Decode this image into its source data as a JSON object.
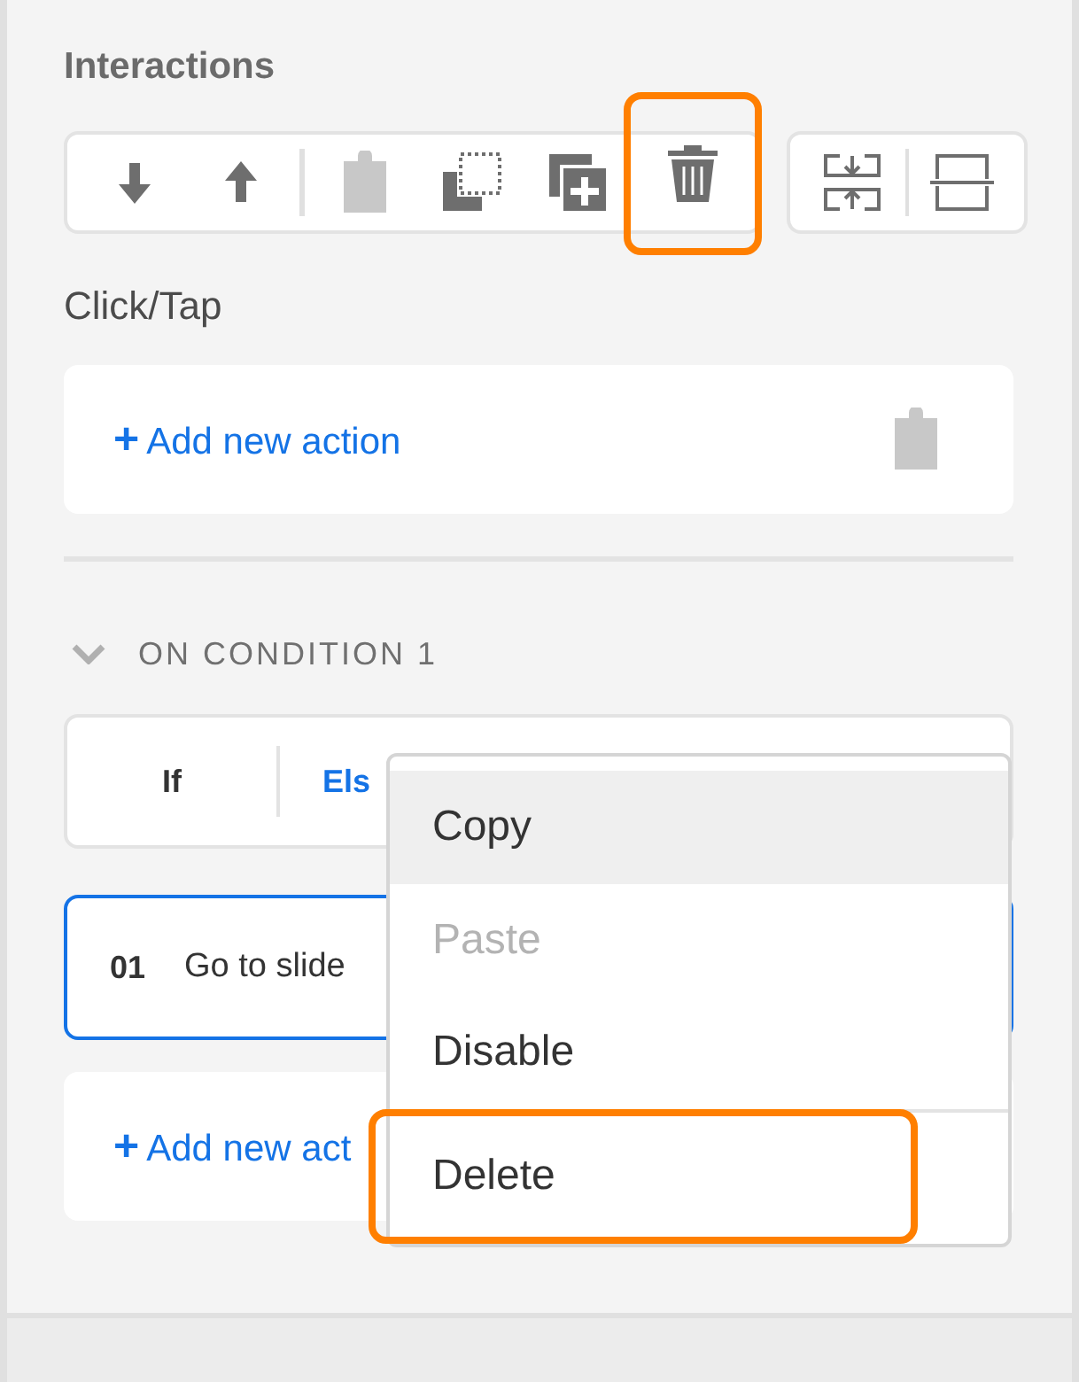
{
  "panel": {
    "title": "Interactions"
  },
  "toolbar": {
    "groups": [
      {
        "tools": [
          {
            "disabled": false,
            "highlighted": false
          },
          {
            "disabled": false,
            "highlighted": false
          },
          {
            "disabled": true,
            "highlighted": false
          },
          {
            "disabled": false,
            "highlighted": false
          },
          {
            "disabled": false,
            "highlighted": false
          },
          {
            "disabled": false,
            "highlighted": true
          }
        ]
      },
      {
        "tools": [
          {
            "disabled": false,
            "highlighted": false
          },
          {
            "disabled": false,
            "highlighted": false
          }
        ]
      }
    ]
  },
  "trigger": {
    "label": "Click/Tap",
    "add_action": {
      "plus": "+",
      "label": "Add new action"
    }
  },
  "condition": {
    "title": "ON CONDITION 1",
    "expanded": true,
    "tabs": [
      {
        "label": "If",
        "selected": false
      },
      {
        "label": "Els",
        "selected": true
      }
    ],
    "actions": [
      {
        "number": "01",
        "label": "Go to slide",
        "selected": true
      }
    ],
    "add_action": {
      "plus": "+",
      "label": "Add new act"
    }
  },
  "context_menu": {
    "items": [
      {
        "label": "Copy",
        "hovered": true,
        "disabled": false,
        "highlighted": false
      },
      {
        "label": "Paste",
        "hovered": false,
        "disabled": true,
        "highlighted": false
      },
      {
        "label": "Disable",
        "hovered": false,
        "disabled": false,
        "highlighted": false
      },
      {
        "label": "Delete",
        "hovered": false,
        "disabled": false,
        "highlighted": true
      }
    ]
  }
}
